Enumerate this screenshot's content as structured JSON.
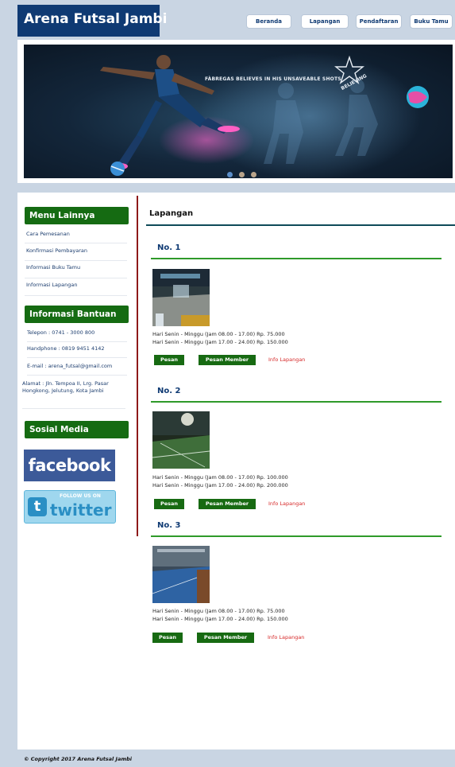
{
  "site": {
    "title": "Arena Futsal Jambi"
  },
  "nav": [
    "Beranda",
    "Lapangan",
    "Pendaftaran",
    "Buku Tamu"
  ],
  "banner": {
    "tagline": "FÀBREGAS BELIEVES IN HIS UNSAVEABLE SHOTS",
    "badge": "BELIEVING"
  },
  "sidebar": {
    "menu_title": "Menu Lainnya",
    "menu_items": [
      "Cara Pemesanan",
      "Konfirmasi Pembayaran",
      "Informasi Buku Tamu",
      "Informasi Lapangan"
    ],
    "help_title": "Informasi Bantuan",
    "help_items": [
      "Telepon : 0741 - 3000 800",
      "Handphone : 0819 9451 4142",
      "E-mail : arena_futsal@gmail.com",
      "Alamat : Jln. Tempoa II, Lrg. Pasar Hongkong, Jelutung, Kota Jambi"
    ],
    "social_title": "Sosial Media",
    "facebook": "facebook",
    "twitter_follow": "FOLLOW US ON",
    "twitter": "twitter"
  },
  "main": {
    "title": "Lapangan",
    "fields": [
      {
        "name": "No. 1",
        "prices": [
          "Hari Senin - Minggu (Jam 08.00 - 17.00) Rp. 75.000",
          "Hari Senin - Minggu (Jam 17.00 - 24.00) Rp. 150.000"
        ]
      },
      {
        "name": "No. 2",
        "prices": [
          "Hari Senin - Minggu (Jam 08.00 - 17.00) Rp. 100.000",
          "Hari Senin - Minggu (Jam 17.00 - 24.00) Rp. 200.000"
        ]
      },
      {
        "name": "No. 3",
        "prices": [
          "Hari Senin - Minggu (Jam 08.00 - 17.00) Rp. 75.000",
          "Hari Senin - Minggu (Jam 17.00 - 24.00) Rp. 150.000"
        ]
      }
    ],
    "buttons": {
      "pesan": "Pesan",
      "member": "Pesan Member",
      "info": "Info Lapangan"
    }
  },
  "footer": {
    "copyright": "© Copyright 2017 Arena Futsal Jambi"
  },
  "colors": {
    "navy": "#0f3a73",
    "green": "#156b12",
    "red_line": "#8e1a1a",
    "link_red": "#d62828",
    "bg": "#c9d5e3"
  }
}
